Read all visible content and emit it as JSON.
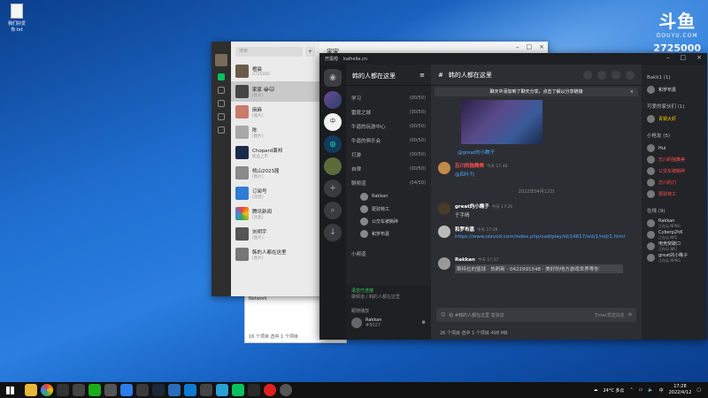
{
  "desktop": {
    "icon_label": "我们好爱你.txt",
    "watermark": {
      "logo": "斗鱼",
      "site": "DOUYU.COM",
      "room_id": "2725000"
    }
  },
  "explorer": {
    "side_item": "Network",
    "status_left": "16 个项目",
    "status_sel": "选中 1 个项目"
  },
  "wechat": {
    "search_placeholder": "搜索",
    "chat_title": "家家",
    "items": [
      {
        "name": "橙晨",
        "sub": "2725000"
      },
      {
        "name": "家家 😂🐱",
        "sub": "[图片]"
      },
      {
        "name": "麻麻",
        "sub": "[图片]"
      },
      {
        "name": "陈",
        "sub": "[图片]"
      },
      {
        "name": "Chopard萧邦",
        "sub": "新品上市"
      },
      {
        "name": "桃山2023届",
        "sub": "[图片]"
      },
      {
        "name": "订阅号",
        "sub": "[消息]"
      },
      {
        "name": "腾讯新闻",
        "sub": "[消息]"
      },
      {
        "name": "刘明宇",
        "sub": "[图片]"
      },
      {
        "name": "韩的人都在这里",
        "sub": "[图片]"
      }
    ]
  },
  "kook": {
    "top_title": "开黑啦",
    "top_url": "kaiheila.cn",
    "server_name": "韩的人都在这里",
    "channels": [
      {
        "name": "学习",
        "count": "(00/50)"
      },
      {
        "name": "雷霆之城",
        "count": "(00/50)"
      },
      {
        "name": "牛逼的玩游中心",
        "count": "(00/50)"
      },
      {
        "name": "牛逼的俱乐会",
        "count": "(00/50)"
      },
      {
        "name": "打游",
        "count": "(00/50)"
      },
      {
        "name": "自律",
        "count": "(00/50)"
      },
      {
        "name": "聊频道",
        "count": "(04/50)"
      }
    ],
    "voice_members": [
      "Rakkan",
      "斑驳特工",
      "公交车被撕碎",
      "和罗布嘉"
    ],
    "bottom_channel": "小频道",
    "voice_status": "语音已连接",
    "voice_sub": "聊频道 / 韩的人都在这里",
    "user_name": "Rakkan",
    "user_tag": "#8027",
    "user_label": "跟随播放",
    "chat_title": "韩的人都在这里",
    "notice": "聊天中添加到了聊天分享，点击了解以分享链接",
    "messages": [
      {
        "name": "@great的小瞧子",
        "time": "",
        "text": ""
      },
      {
        "name": "忘川的独舞美",
        "time": "今天 17:46",
        "text": "@四叶为"
      },
      {
        "name": "great的小瞧子",
        "time": "今天 17:26",
        "text": "于手晴"
      },
      {
        "name": "和罗布嘉",
        "time": "今天 17:26",
        "text": "https://www.olevod.com/index.php/vod/play/id/14617/sid/1/nid/1.html"
      },
      {
        "name": "Rakkan",
        "time": "今天 17:27",
        "text": "斯特拉的篮球 · 热刷新 · 0422991548 · 美好的地方游戏世界等你"
      }
    ],
    "date_divider": "2022年04月12日",
    "input_placeholder": "给 #韩的人都在这里 发消息",
    "send_hint": "Enter发送消息",
    "members_header": "Bakk1 (1)",
    "groups": [
      {
        "title": "Bakk1 (1)",
        "members": [
          {
            "n": "和罗布嘉",
            "c": "n"
          }
        ]
      },
      {
        "title": "可爱的家伙们 (1)",
        "members": [
          {
            "n": "青铜大虾",
            "c": "y"
          }
        ]
      },
      {
        "title": "小枪友 (5)",
        "members": [
          {
            "n": "Hui",
            "c": "n"
          },
          {
            "n": "忘川的独舞美",
            "c": "r"
          },
          {
            "n": "公交车被撕碎",
            "c": "r"
          },
          {
            "n": "忘川的刀",
            "c": "r"
          },
          {
            "n": "斑驳特工",
            "c": "r"
          }
        ]
      },
      {
        "title": "在线 (9)",
        "members": [
          {
            "n": "Rakkan",
            "c": "n",
            "s": "正在玩 NPNG"
          },
          {
            "n": "Cyberp2hK",
            "c": "n",
            "s": "正在玩 NP2"
          },
          {
            "n": "电竞突破口",
            "c": "n",
            "s": "正在玩 脚行"
          },
          {
            "n": "great的小瞧子",
            "c": "n",
            "s": "正在玩 NPNG"
          }
        ]
      }
    ],
    "status_bar": "26 个项目    选中 1 个项目 498 MB"
  },
  "taskbar": {
    "weather": "24°C 多云",
    "time": "17:28",
    "date": "2022/4/12"
  },
  "colors": {
    "accent_green": "#07c160",
    "link": "#4aa8ff",
    "alert_red": "#ff4d4d"
  }
}
